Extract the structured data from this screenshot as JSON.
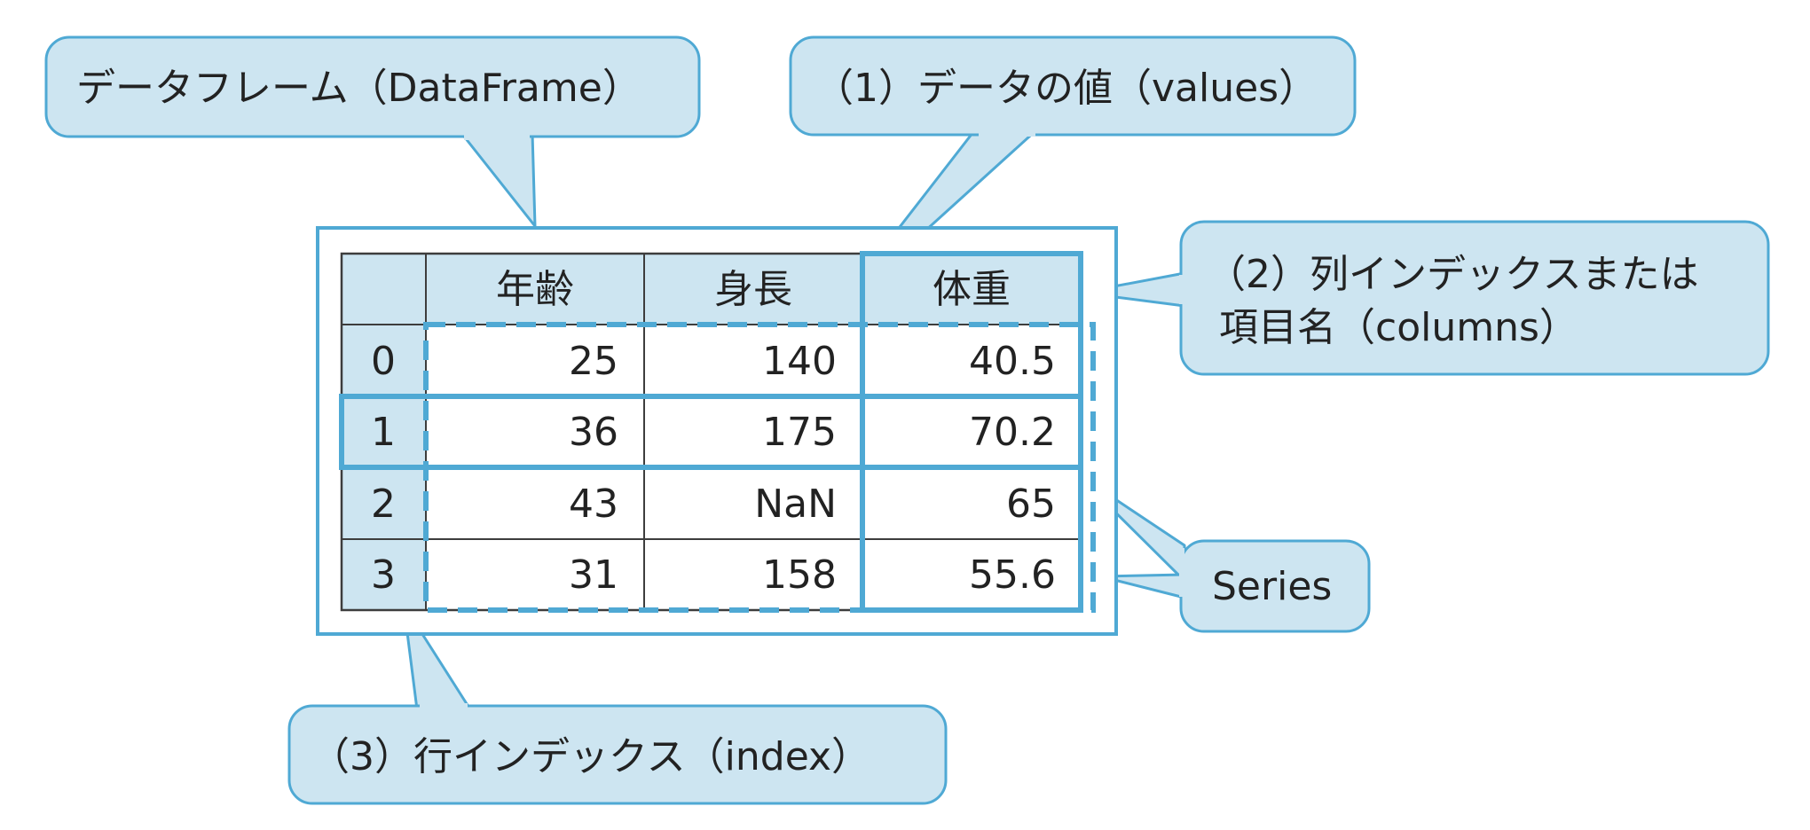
{
  "colors": {
    "accent": "#4fa9d4",
    "callout_fill": "#cde5f1",
    "header_fill": "#cde5f1",
    "grid": "#3d3d3d",
    "text": "#222222"
  },
  "callouts": {
    "dataframe": "データフレーム（DataFrame）",
    "values": "（1）データの値（values）",
    "columns_line1": "（2）列インデックスまたは",
    "columns_line2": "項目名（columns）",
    "series": "Series",
    "index": "（3）行インデックス（index）"
  },
  "table": {
    "columns": [
      "年齢",
      "身長",
      "体重"
    ],
    "rows": [
      {
        "index": "0",
        "cells": [
          "25",
          "140",
          "40.5"
        ]
      },
      {
        "index": "1",
        "cells": [
          "36",
          "175",
          "70.2"
        ]
      },
      {
        "index": "2",
        "cells": [
          "43",
          "NaN",
          "65"
        ]
      },
      {
        "index": "3",
        "cells": [
          "31",
          "158",
          "55.6"
        ]
      }
    ]
  }
}
